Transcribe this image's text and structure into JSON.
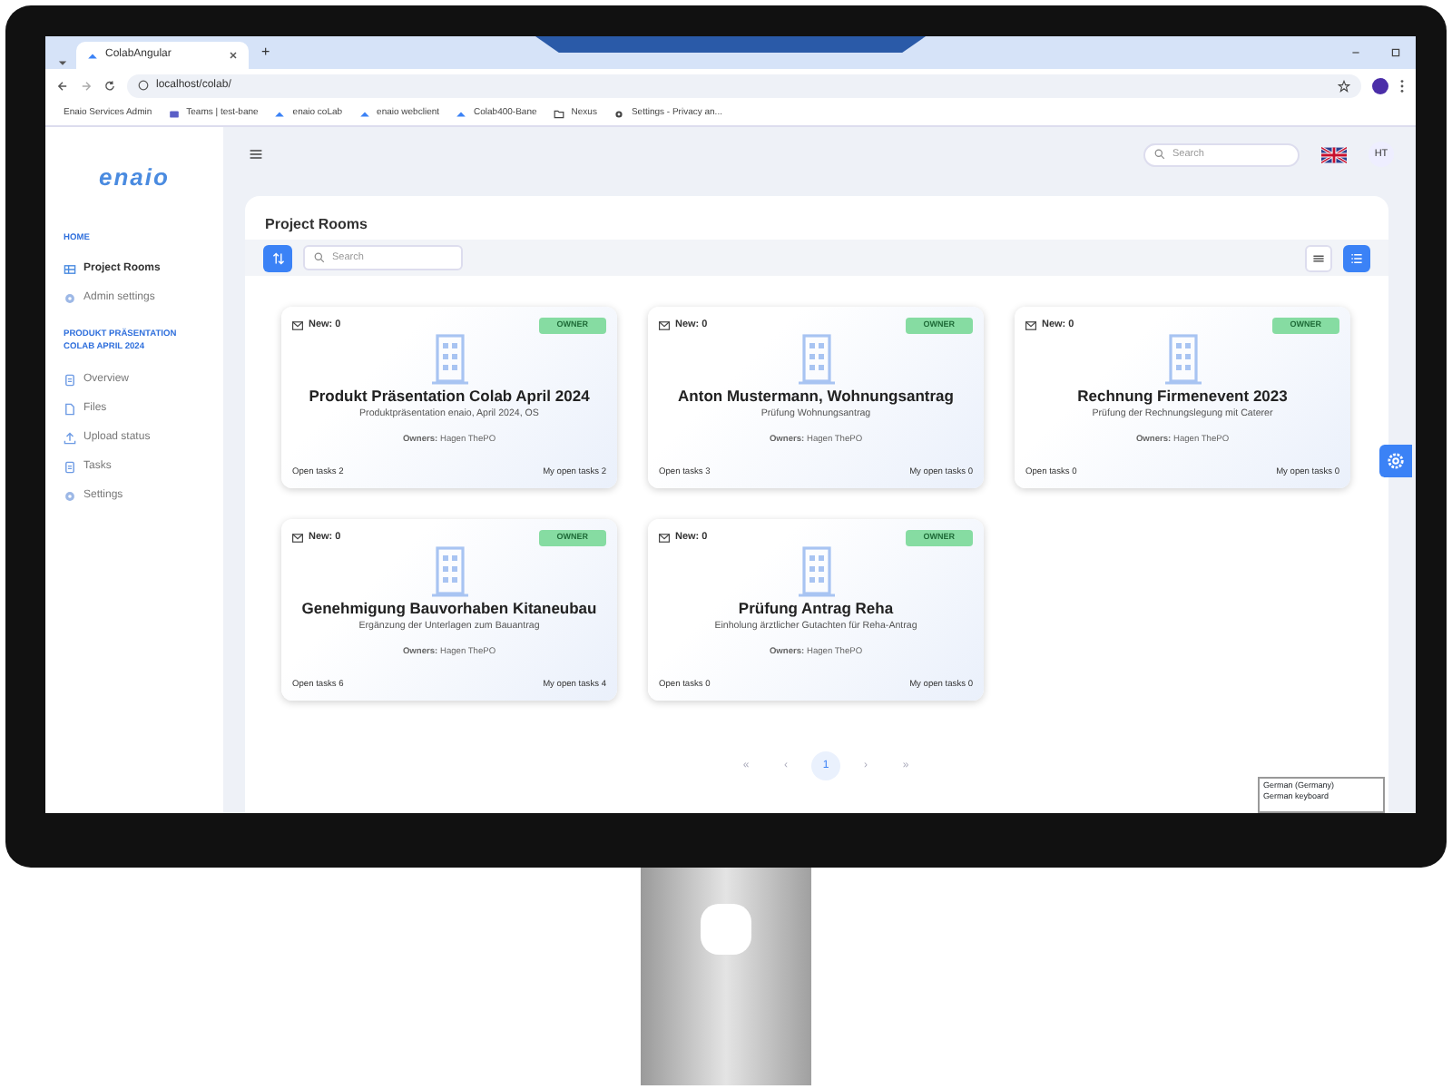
{
  "browser": {
    "tab_title": "ColabAngular",
    "new_tab": "+",
    "url": "localhost/colab/",
    "bookmarks": [
      {
        "label": "Enaio Services Admin",
        "kind": "none"
      },
      {
        "label": "Teams | test-bane",
        "kind": "teams"
      },
      {
        "label": "enaio coLab",
        "kind": "enaio"
      },
      {
        "label": "enaio webclient",
        "kind": "enaio"
      },
      {
        "label": "Colab400-Bane",
        "kind": "enaio"
      },
      {
        "label": "Nexus",
        "kind": "folder"
      },
      {
        "label": "Settings - Privacy an...",
        "kind": "gear"
      }
    ]
  },
  "sidebar": {
    "logo": "enaio",
    "sections": [
      {
        "heading": "HOME",
        "items": [
          {
            "label": "Project Rooms",
            "kind": "grid",
            "selected": true
          },
          {
            "label": "Admin settings",
            "kind": "gear",
            "selected": false
          }
        ]
      },
      {
        "heading": "PRODUKT PRÄSENTATION COLAB APRIL 2024",
        "items": [
          {
            "label": "Overview",
            "kind": "doc",
            "selected": false
          },
          {
            "label": "Files",
            "kind": "file",
            "selected": false
          },
          {
            "label": "Upload status",
            "kind": "upload",
            "selected": false
          },
          {
            "label": "Tasks",
            "kind": "doc",
            "selected": false
          },
          {
            "label": "Settings",
            "kind": "gear",
            "selected": false
          }
        ]
      }
    ]
  },
  "header": {
    "search_placeholder": "Search",
    "user_initials": "HT"
  },
  "panel": {
    "title": "Project Rooms",
    "search_placeholder": "Search",
    "views": [
      {
        "kind": "list",
        "selected": false
      },
      {
        "kind": "grid",
        "selected": true
      }
    ],
    "rooms": [
      {
        "new": "New: 0",
        "role": "OWNER",
        "title": "Produkt Präsentation Colab April 2024",
        "description": "Produktpräsentation enaio, April 2024, OS",
        "owners": "**Owners:** Hagen ThePO",
        "open_tasks": "Open tasks 2",
        "my_open_tasks": "My open tasks 2"
      },
      {
        "new": "New: 0",
        "role": "OWNER",
        "title": "Anton Mustermann, Wohnungsantrag",
        "description": "Prüfung Wohnungsantrag",
        "owners": "**Owners:** Hagen ThePO",
        "open_tasks": "Open tasks 3",
        "my_open_tasks": "My open tasks 0"
      },
      {
        "new": "New: 0",
        "role": "OWNER",
        "title": "Rechnung Firmenevent 2023",
        "description": "Prüfung der Rechnungslegung mit Caterer",
        "owners": "**Owners:** Hagen ThePO",
        "open_tasks": "Open tasks 0",
        "my_open_tasks": "My open tasks 0"
      },
      {
        "new": "New: 0",
        "role": "OWNER",
        "title": "Genehmigung Bauvorhaben Kitaneubau",
        "description": "Ergänzung der Unterlagen zum Bauantrag",
        "owners": "**Owners:** Hagen ThePO",
        "open_tasks": "Open tasks 6",
        "my_open_tasks": "My open tasks 4"
      },
      {
        "new": "New: 0",
        "role": "OWNER",
        "title": "Prüfung Antrag Reha",
        "description": "Einholung ärztlicher Gutachten für Reha-Antrag",
        "owners": "**Owners:** Hagen ThePO",
        "open_tasks": "Open tasks 0",
        "my_open_tasks": "My open tasks 0"
      }
    ],
    "pagination": [
      {
        "label": "«",
        "selected": false
      },
      {
        "label": "‹",
        "selected": false
      },
      {
        "label": "1",
        "selected": true
      },
      {
        "label": "›",
        "selected": false
      },
      {
        "label": "»",
        "selected": false
      }
    ]
  },
  "ime_popup": {
    "lines": [
      "German (Germany)",
      "German keyboard"
    ]
  }
}
